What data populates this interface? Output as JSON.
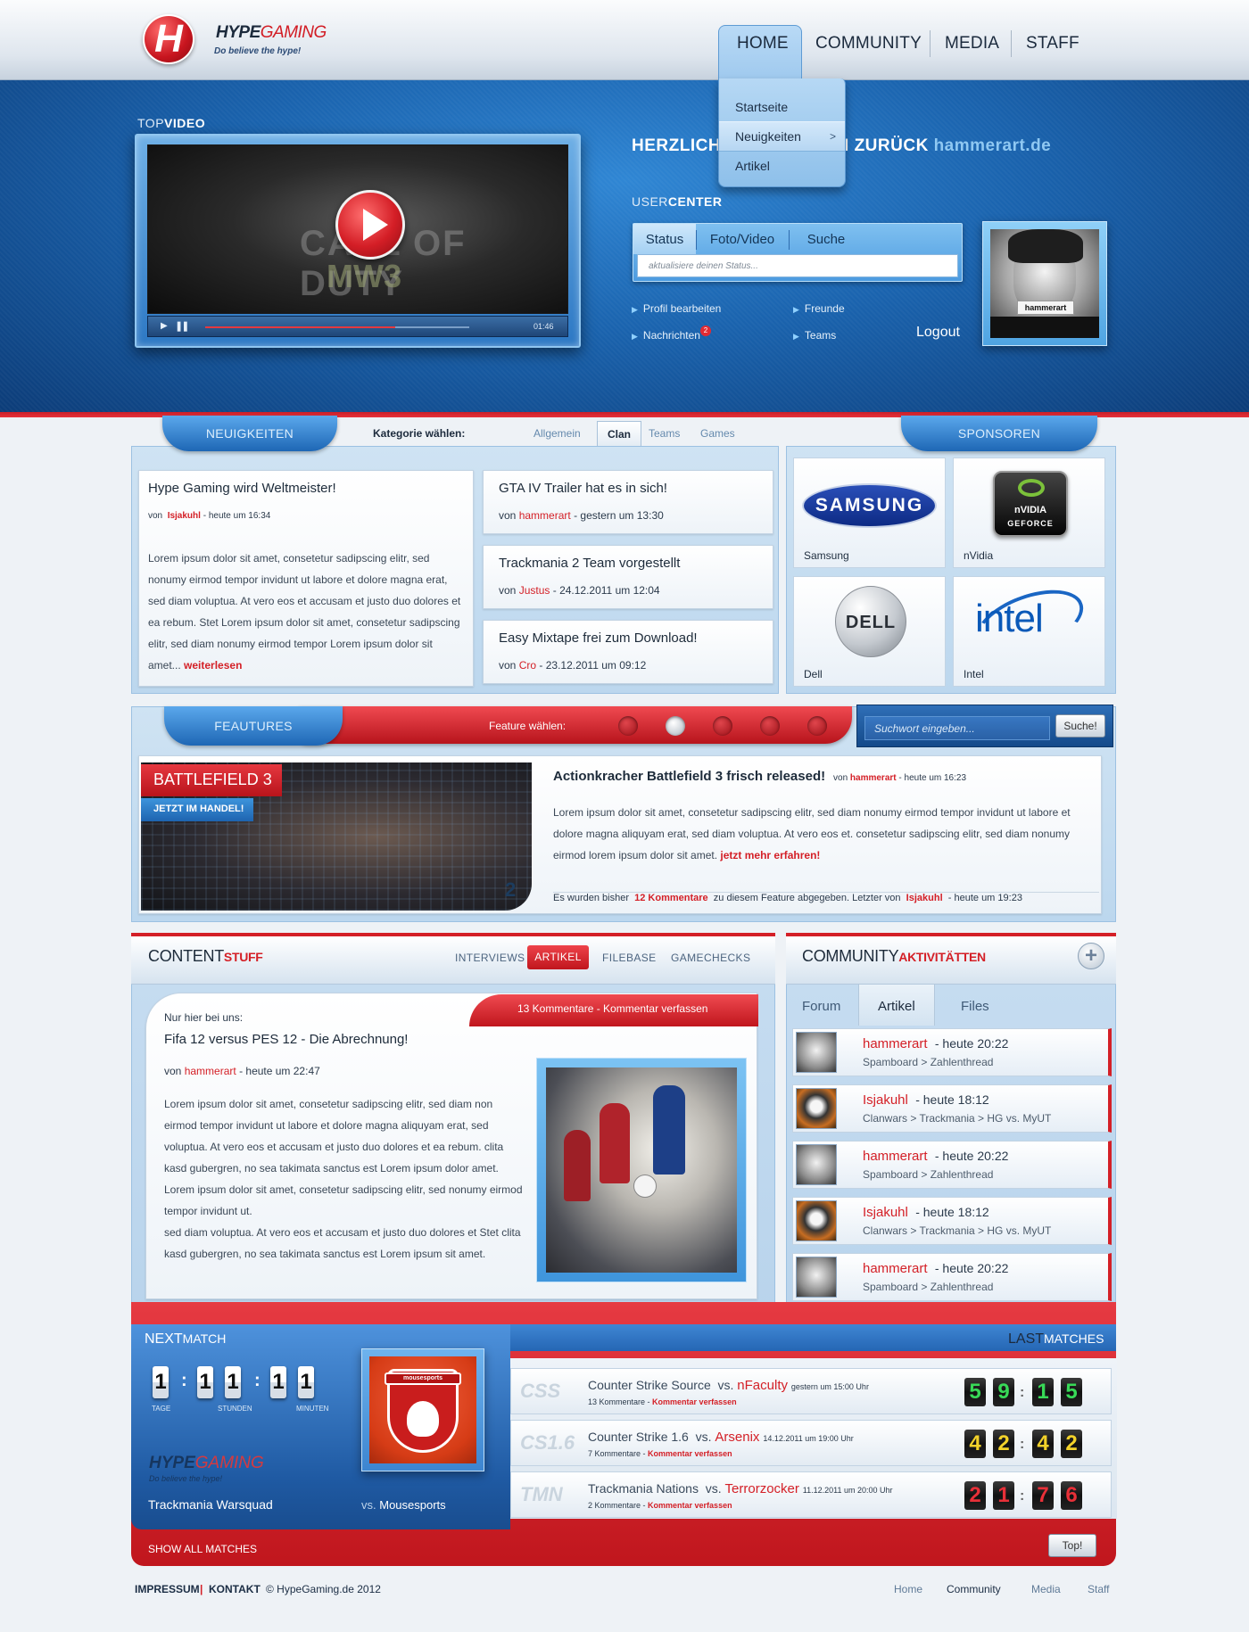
{
  "brand": {
    "name_a": "HYPE",
    "name_b": "GAMING",
    "slogan": "Do believe the hype!",
    "logo_letter": "H"
  },
  "nav": {
    "items": [
      {
        "label": "HOME"
      },
      {
        "label": "COMMUNITY"
      },
      {
        "label": "MEDIA"
      },
      {
        "label": "STAFF"
      }
    ],
    "dropdown": [
      "Startseite",
      "Neuigkeiten",
      "Artikel"
    ],
    "dropdown_arrow": ">"
  },
  "topvideo": {
    "label_a": "TOP",
    "label_b": "VIDEO",
    "bg_title": "CALL OF DUTY",
    "bg_sub": "MW3",
    "time": "01:46",
    "progress": 0.72
  },
  "welcome": {
    "text": "HERZLICH WILLKOMMEN ZURÜCK ",
    "site": "hammerart.de"
  },
  "usercenter": {
    "label_a": "USER",
    "label_b": "CENTER",
    "tabs": [
      "Status",
      "Foto/Video",
      "Suche"
    ],
    "status_placeholder": "aktualisiere deinen Status...",
    "links": [
      "Profil bearbeiten",
      "Freunde",
      "Nachrichten",
      "Teams"
    ],
    "messages_badge": "2",
    "logout": "Logout",
    "avatar_tape": "hammerart"
  },
  "news": {
    "tab": "NEUIGKEITEN",
    "category_label": "Kategorie wählen:",
    "categories": [
      "Allgemein",
      "Clan",
      "Teams",
      "Games"
    ],
    "active_category": "Clan",
    "main": {
      "title": "Hype Gaming wird Weltmeister!",
      "by": "von",
      "user": "Isjakuhl",
      "date": "- heute um 16:34",
      "body": "Lorem ipsum dolor sit amet, consetetur sadipscing elitr, sed nonumy eirmod tempor invidunt ut labore et dolore magna erat, sed diam voluptua. At vero eos et accusam et justo duo dolores et ea rebum. Stet Lorem ipsum dolor sit amet, consetetur sadipscing elitr, sed diam nonumy eirmod tempor Lorem ipsum dolor sit amet...",
      "more": "weiterlesen"
    },
    "items": [
      {
        "title": "GTA IV Trailer hat es in sich!",
        "by": "von",
        "user": "hammerart",
        "date": "- gestern um 13:30"
      },
      {
        "title": "Trackmania 2 Team vorgestellt",
        "by": "von",
        "user": "Justus",
        "date": "- 24.12.2011 um 12:04"
      },
      {
        "title": "Easy Mixtape frei zum Download!",
        "by": "von",
        "user": "Cro",
        "date": "- 23.12.2011 um 09:12"
      }
    ]
  },
  "sponsors": {
    "tab": "SPONSOREN",
    "items": [
      {
        "name": "Samsung",
        "logo": "SAMSUNG"
      },
      {
        "name": "nVidia",
        "logo": "nVIDIA",
        "logo_sub": "GEFORCE"
      },
      {
        "name": "Dell",
        "logo": "DELL"
      },
      {
        "name": "Intel",
        "logo": "intel"
      }
    ]
  },
  "features": {
    "tab": "FEAUTURES",
    "choose_label": "Feature wählen:",
    "dots": 5,
    "active_dot": 2,
    "search_placeholder": "Suchwort eingeben...",
    "search_button": "Suche!",
    "game_tag": "BATTLEFIELD 3",
    "game_sub": "JETZT IM HANDEL!",
    "image_number": "2",
    "title": "Actionkracher Battlefield 3 frisch released!",
    "by": "von",
    "user": "hammerart",
    "date": "- heute um 16:23",
    "body": "Lorem ipsum dolor sit amet, consetetur sadipscing elitr, sed diam nonumy eirmod tempor invidunt ut labore et dolore magna aliquyam erat, sed diam voluptua. At vero eos et. consetetur sadipscing elitr, sed diam nonumy eirmod lorem ipsum dolor sit amet.",
    "more": "jetzt mehr erfahren!",
    "comments_pre": "Es wurden bisher",
    "comments_count": "12 Kommentare",
    "comments_mid": "zu diesem Feature abgegeben. Letzter von",
    "comments_user": "Isjakuhl",
    "comments_date": "- heute um 19:23"
  },
  "content": {
    "title_a": "CONTENT",
    "title_b": "STUFF",
    "tabs": [
      "INTERVIEWS",
      "ARTIKEL",
      "FILEBASE",
      "GAMECHECKS"
    ],
    "active_tab": "ARTIKEL",
    "comments_banner": "13 Kommentare  - Kommentar verfassen",
    "kicker": "Nur hier bei uns:",
    "title": "Fifa 12 versus PES 12 - Die Abrechnung!",
    "by": "von",
    "user": "hammerart",
    "date": "- heute um 22:47",
    "body1": "Lorem ipsum dolor sit amet, consetetur sadipscing elitr, sed diam non eirmod tempor invidunt ut labore et dolore magna aliquyam erat, sed voluptua. At vero eos et accusam et justo duo dolores et ea rebum. clita kasd gubergren, no sea takimata sanctus est Lorem ipsum dolor amet. Lorem ipsum dolor sit amet, consetetur sadipscing elitr, sed nonumy eirmod tempor invidunt ut.",
    "body2": "sed diam voluptua. At vero eos et accusam et justo duo dolores et Stet clita kasd gubergren, no sea takimata sanctus est Lorem ipsum sit amet."
  },
  "community": {
    "title_a": "COMMUNITY",
    "title_b": "AKTIVITÄTTEN",
    "plus": "+",
    "tabs": [
      "Forum",
      "Artikel",
      "Files"
    ],
    "active_tab": "Artikel",
    "activities": [
      {
        "user": "hammerart",
        "time": "- heute 20:22",
        "path": "Spamboard  >  Zahlenthread",
        "avatar": "face"
      },
      {
        "user": "Isjakuhl",
        "time": "- heute 18:12",
        "path": "Clanwars  >  Trackmania  >  HG vs. MyUT",
        "avatar": "panda"
      },
      {
        "user": "hammerart",
        "time": "- heute 20:22",
        "path": "Spamboard  >  Zahlenthread",
        "avatar": "face"
      },
      {
        "user": "Isjakuhl",
        "time": "- heute 18:12",
        "path": "Clanwars  >  Trackmania  >  HG vs. MyUT",
        "avatar": "panda"
      },
      {
        "user": "hammerart",
        "time": "- heute 20:22",
        "path": "Spamboard  >  Zahlenthread",
        "avatar": "face"
      }
    ]
  },
  "nextmatch": {
    "label_a": "NEXT",
    "label_b": "MATCH",
    "countdown": {
      "days": [
        "1"
      ],
      "hours": [
        "1",
        "1"
      ],
      "minutes": [
        "1",
        "1"
      ],
      "tage": "TAGE",
      "stunden": "STUNDEN",
      "minuten": "MINUTEN",
      "d_digits": [
        "1"
      ],
      "h_digits": [
        "1",
        "1"
      ],
      "m_digits": [
        "1",
        "1"
      ]
    },
    "home_team": "Trackmania Warsquad",
    "vs": "vs.",
    "away_team": "Mousesports",
    "clan_logo_text": "mousesports",
    "show_all": "SHOW ALL MATCHES",
    "hype_logo_a": "HYPE",
    "hype_logo_b": "GAMING",
    "hype_slogan": "Do believe the hype!"
  },
  "lastmatches": {
    "label_a": "LAST",
    "label_b": "MATCHES",
    "top_button": "Top!",
    "matches": [
      {
        "game": "CSS",
        "game_name": "Counter Strike Source",
        "vs": "vs.",
        "opponent": "nFaculty",
        "date": "gestern um 15:00 Uhr",
        "comments": "13 Kommentare",
        "write": "Kommentar verfassen",
        "score": [
          "5",
          "9",
          "1",
          "5"
        ],
        "color": "#38d957"
      },
      {
        "game": "CS1.6",
        "game_name": "Counter Strike 1.6",
        "vs": "vs.",
        "opponent": "Arsenix",
        "date": "14.12.2011 um 19:00 Uhr",
        "comments": "7 Kommentare",
        "write": "Kommentar verfassen",
        "score": [
          "4",
          "2",
          "4",
          "2"
        ],
        "color": "#f2d22a"
      },
      {
        "game": "TMN",
        "game_name": "Trackmania Nations",
        "vs": "vs.",
        "opponent": "Terrorzocker",
        "date": "11.12.2011 um 20:00 Uhr",
        "comments": "2 Kommentare",
        "write": "Kommentar verfassen",
        "score": [
          "2",
          "1",
          "7",
          "6"
        ],
        "color": "#e83038"
      }
    ]
  },
  "footer": {
    "impressum": "IMPRESSUM",
    "sep": "|",
    "kontakt": "KONTAKT",
    "copyright": "© HypeGaming.de 2012",
    "links": [
      "Home",
      "Community",
      "Media",
      "Staff"
    ],
    "active_link": "Community"
  },
  "colors": {
    "accent_red": "#d42027",
    "brand_blue": "#1e67b5"
  }
}
